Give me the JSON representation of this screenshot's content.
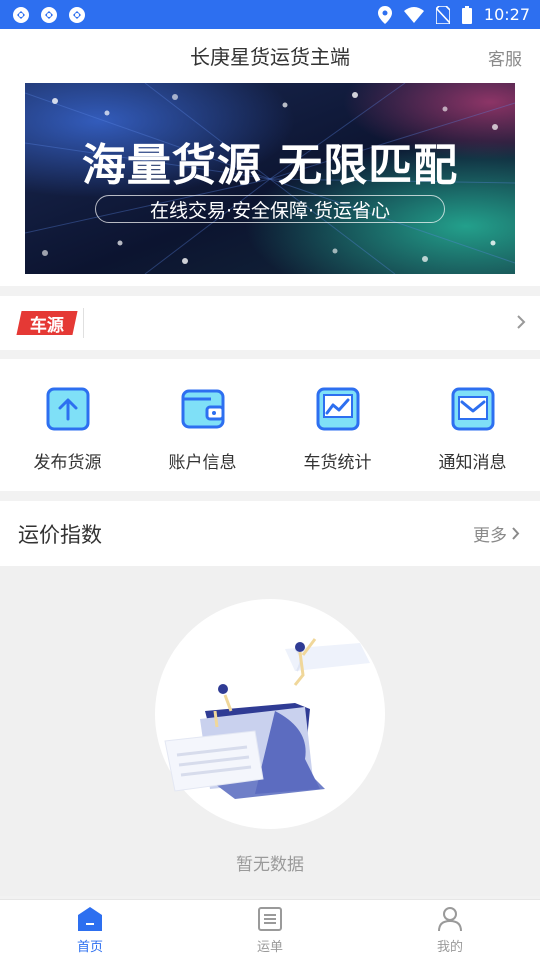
{
  "status_bar": {
    "time": "10:27"
  },
  "header": {
    "title": "长庚星货运货主端",
    "service": "客服"
  },
  "banner": {
    "headline": "海量货源  无限匹配",
    "subline": "在线交易·安全保障·货运省心"
  },
  "car_source": {
    "tag": "车源"
  },
  "actions": [
    {
      "label": "发布货源",
      "icon": "upload-icon"
    },
    {
      "label": "账户信息",
      "icon": "wallet-icon"
    },
    {
      "label": "车货统计",
      "icon": "chart-icon"
    },
    {
      "label": "通知消息",
      "icon": "envelope-icon"
    }
  ],
  "freight_index": {
    "title": "运价指数",
    "more": "更多"
  },
  "empty_state": {
    "text": "暂无数据"
  },
  "bottom_nav": [
    {
      "label": "首页",
      "icon": "home-icon",
      "active": true
    },
    {
      "label": "运单",
      "icon": "list-icon",
      "active": false
    },
    {
      "label": "我的",
      "icon": "person-icon",
      "active": false
    }
  ],
  "colors": {
    "primary": "#2d6ff0",
    "tag_red": "#e53935",
    "icon_fill": "#7fe0f7"
  }
}
